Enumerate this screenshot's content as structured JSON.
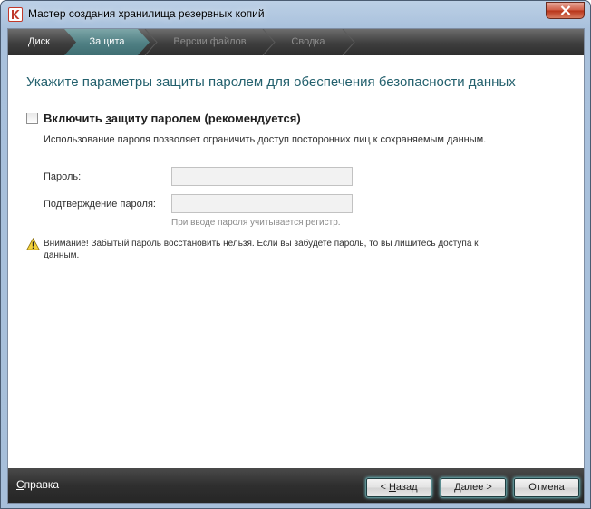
{
  "window": {
    "title": "Мастер создания хранилища резервных копий"
  },
  "steps": [
    {
      "label": "Диск",
      "state": "done"
    },
    {
      "label": "Защита",
      "state": "active"
    },
    {
      "label": "Версии файлов",
      "state": "disabled"
    },
    {
      "label": "Сводка",
      "state": "disabled"
    }
  ],
  "content": {
    "title": "Укажите параметры защиты паролем для обеспечения безопасности данных",
    "enable_checkbox": {
      "label_pre": "Включить ",
      "label_underline": "з",
      "label_post": "ащиту паролем (рекомендуется)",
      "checked": false
    },
    "description": "Использование пароля позволяет ограничить доступ посторонних лиц к сохраняемым данным.",
    "password_label": "Пароль:",
    "password_value": "",
    "confirm_label": "Подтверждение пароля:",
    "confirm_value": "",
    "hint": "При вводе пароля учитывается регистр.",
    "warning": "Внимание! Забытый пароль восстановить нельзя. Если вы забудете пароль, то вы лишитесь доступа к данным."
  },
  "footer": {
    "help": "Справка",
    "back_pre": "< ",
    "back_u": "Н",
    "back_post": "азад",
    "next_u": "Д",
    "next_post": "алее >",
    "cancel": "Отмена"
  },
  "colors": {
    "accent": "#23606d",
    "step_active": "#4f7f83",
    "close": "#c44a2f"
  }
}
